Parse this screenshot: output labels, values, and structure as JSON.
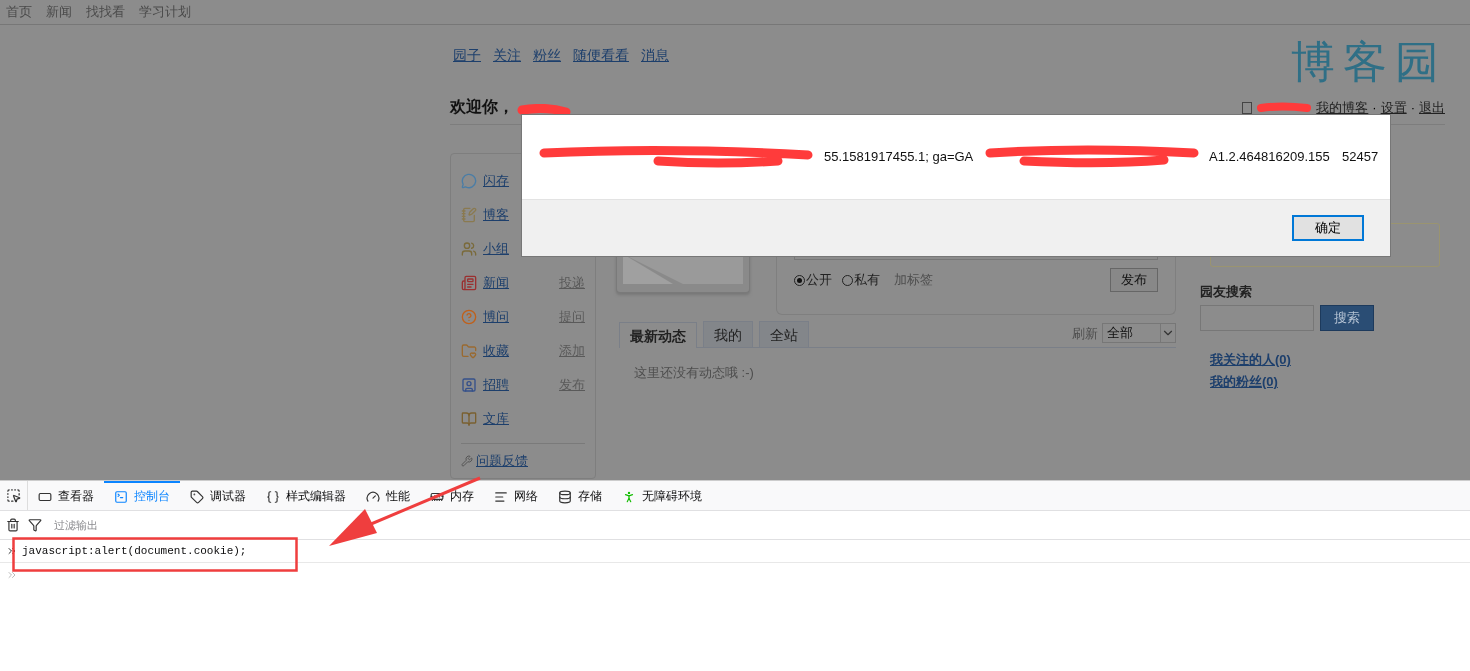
{
  "top_nav": [
    "首页",
    "新闻",
    "找找看",
    "学习计划"
  ],
  "site_nav": [
    "园子",
    "关注",
    "粉丝",
    "随便看看",
    "消息"
  ],
  "logo": "博客园",
  "welcome": {
    "greeting": "欢迎你，",
    "links": [
      "我的博客",
      "设置",
      "退出"
    ],
    "separator": "·"
  },
  "sidebar": {
    "items": [
      {
        "label": "闪存"
      },
      {
        "label": "博客"
      },
      {
        "label": "小组"
      },
      {
        "label": "新闻",
        "action": "投递"
      },
      {
        "label": "博问",
        "action": "提问"
      },
      {
        "label": "收藏",
        "action": "添加"
      },
      {
        "label": "招聘",
        "action": "发布"
      },
      {
        "label": "文库"
      }
    ],
    "footer": "问题反馈"
  },
  "post_form": {
    "radios": [
      {
        "label": "公开",
        "selected": true
      },
      {
        "label": "私有",
        "selected": false
      }
    ],
    "tag_link": "加标签",
    "submit": "发布"
  },
  "feed": {
    "tabs": [
      {
        "label": "最新动态",
        "selected": true
      },
      {
        "label": "我的",
        "selected": false
      },
      {
        "label": "全站",
        "selected": false
      }
    ],
    "refresh": "刷新",
    "filter": "全部",
    "empty": "这里还没有动态哦 :-)"
  },
  "people_search": {
    "title": "园友搜索",
    "button": "搜索",
    "links": [
      "我关注的人(0)",
      "我的粉丝(0)"
    ]
  },
  "dialog": {
    "message_fragments": [
      "55.1581917455.1;  ga=GA",
      "A1.2.464816209.155",
      "52457"
    ],
    "ok": "确定"
  },
  "devtools": {
    "tabs": [
      {
        "label": "查看器",
        "selected": false
      },
      {
        "label": "控制台",
        "selected": true
      },
      {
        "label": "调试器",
        "selected": false
      },
      {
        "label": "样式编辑器",
        "selected": false
      },
      {
        "label": "性能",
        "selected": false
      },
      {
        "label": "内存",
        "selected": false
      },
      {
        "label": "网络",
        "selected": false
      },
      {
        "label": "存储",
        "selected": false
      },
      {
        "label": "无障碍环境",
        "selected": false
      }
    ],
    "filter_placeholder": "过滤输出",
    "input": "javascript:alert(document.cookie);"
  }
}
